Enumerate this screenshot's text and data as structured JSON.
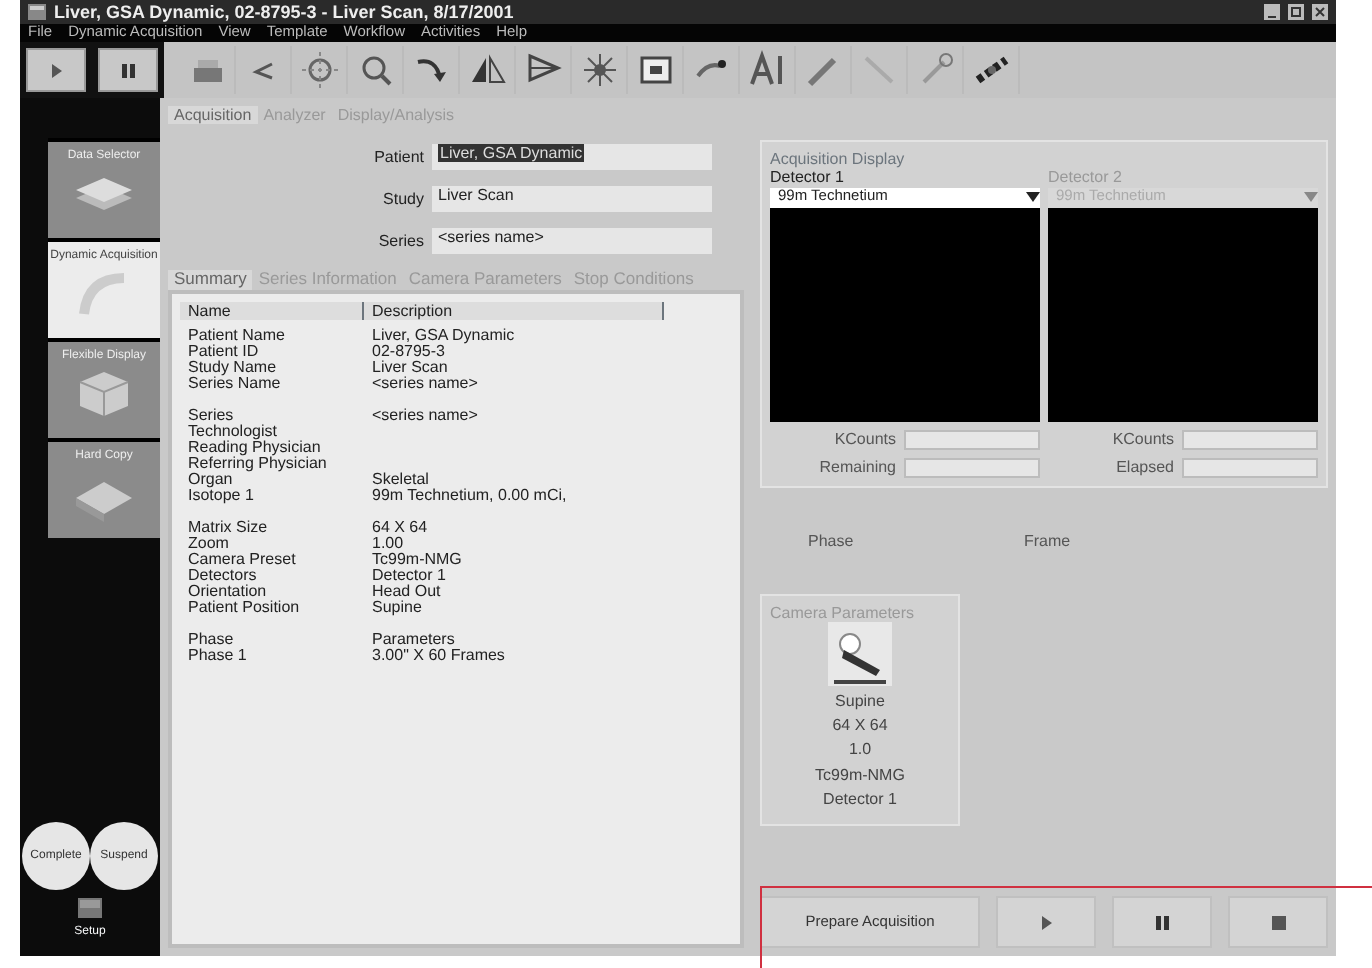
{
  "window": {
    "title": "Liver, GSA Dynamic, 02-8795-3 - Liver Scan, 8/17/2001"
  },
  "menu": [
    "File",
    "Dynamic Acquisition",
    "View",
    "Template",
    "Workflow",
    "Activities",
    "Help"
  ],
  "sidebar": [
    {
      "label": "Data Selector",
      "kind": "stack",
      "selected": false
    },
    {
      "label": "Dynamic Acquisition",
      "kind": "arc",
      "selected": true
    },
    {
      "label": "Flexible Display",
      "kind": "box",
      "selected": false
    },
    {
      "label": "Hard Copy",
      "kind": "tray",
      "selected": false
    }
  ],
  "round_buttons": [
    "Complete",
    "Suspend"
  ],
  "setup": {
    "label": "Setup"
  },
  "tabs": [
    {
      "label": "Acquisition",
      "selected": true
    },
    {
      "label": "Analyzer",
      "selected": false
    },
    {
      "label": "Display/Analysis",
      "selected": false
    }
  ],
  "fields": [
    {
      "label": "Patient",
      "value": "Liver, GSA Dynamic",
      "highlighted": true
    },
    {
      "label": "Study",
      "value": "Liver Scan",
      "highlighted": false
    },
    {
      "label": "Series",
      "value": "<series name>",
      "highlighted": false
    }
  ],
  "subtabs": [
    {
      "label": "Summary",
      "selected": true
    },
    {
      "label": "Series Information",
      "selected": false
    },
    {
      "label": "Camera Parameters",
      "selected": false
    },
    {
      "label": "Stop Conditions",
      "selected": false
    }
  ],
  "summary": {
    "columns": [
      "Name",
      "Description"
    ],
    "groups": [
      [
        {
          "name": "Patient Name",
          "description": "Liver, GSA Dynamic"
        },
        {
          "name": "Patient ID",
          "description": "02-8795-3"
        },
        {
          "name": "Study Name",
          "description": "Liver Scan"
        },
        {
          "name": "Series Name",
          "description": "<series name>"
        }
      ],
      [
        {
          "name": "Series",
          "description": "<series name>"
        },
        {
          "name": "Technologist"
        },
        {
          "name": "Reading Physician"
        },
        {
          "name": "Referring Physician"
        },
        {
          "name": "Organ",
          "description": "Skeletal"
        },
        {
          "name": "Isotope 1",
          "description": "99m Technetium, 0.00 mCi,"
        }
      ],
      [
        {
          "name": "Matrix Size",
          "description": "64 X 64"
        },
        {
          "name": "Zoom",
          "description": "1.00"
        },
        {
          "name": "Camera Preset",
          "description": "Tc99m-NMG"
        },
        {
          "name": "Detectors",
          "description": "Detector 1"
        },
        {
          "name": "Orientation",
          "description": "Head Out"
        },
        {
          "name": "Patient Position",
          "description": "Supine"
        }
      ],
      [
        {
          "name": "Phase",
          "description": "Parameters"
        },
        {
          "name": "Phase  1",
          "description": "3.00\" X 60  Frames"
        }
      ]
    ]
  },
  "acquisition_display": {
    "title": "Acquisition Display",
    "detectors": [
      {
        "label": "Detector 1",
        "isotope": "99m Technetium",
        "disabled": false,
        "counters": [
          "KCounts",
          "Remaining"
        ]
      },
      {
        "label": "Detector 2",
        "isotope": "99m Technetium",
        "disabled": true,
        "counters": [
          "KCounts",
          "Elapsed"
        ]
      }
    ]
  },
  "phase_labels": [
    "Phase",
    "Frame"
  ],
  "camera_parameters": {
    "title": "Camera Parameters",
    "lines": [
      "Supine",
      "64 X 64",
      "1.0",
      "Tc99m-NMG",
      "Detector 1"
    ]
  },
  "actions": [
    {
      "kind": "text",
      "label": "Prepare Acquisition"
    },
    {
      "kind": "play"
    },
    {
      "kind": "pause"
    },
    {
      "kind": "stop"
    }
  ]
}
